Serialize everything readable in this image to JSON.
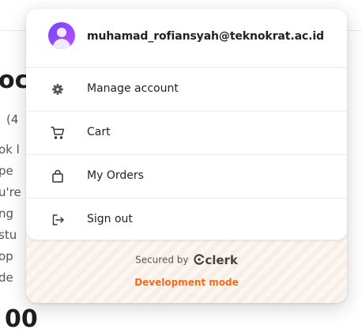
{
  "background": {
    "heading_top": "oc",
    "line_count": "(4",
    "lines": [
      "ok l",
      "pe",
      "u're",
      "ng",
      "stu",
      "op",
      "de"
    ],
    "heading_bottom": "00"
  },
  "popover": {
    "email": "muhamad_rofiansyah@teknokrat.ac.id",
    "menu": [
      {
        "label": "Manage account",
        "icon": "gear-icon"
      },
      {
        "label": "Cart",
        "icon": "cart-icon"
      },
      {
        "label": "My Orders",
        "icon": "shopping-bag-icon"
      },
      {
        "label": "Sign out",
        "icon": "sign-out-icon"
      }
    ],
    "secured_by": "Secured by",
    "brand": "clerk",
    "dev_mode": "Development mode"
  },
  "colors": {
    "accent": "#f36b16",
    "avatar": "#6c47ff"
  }
}
